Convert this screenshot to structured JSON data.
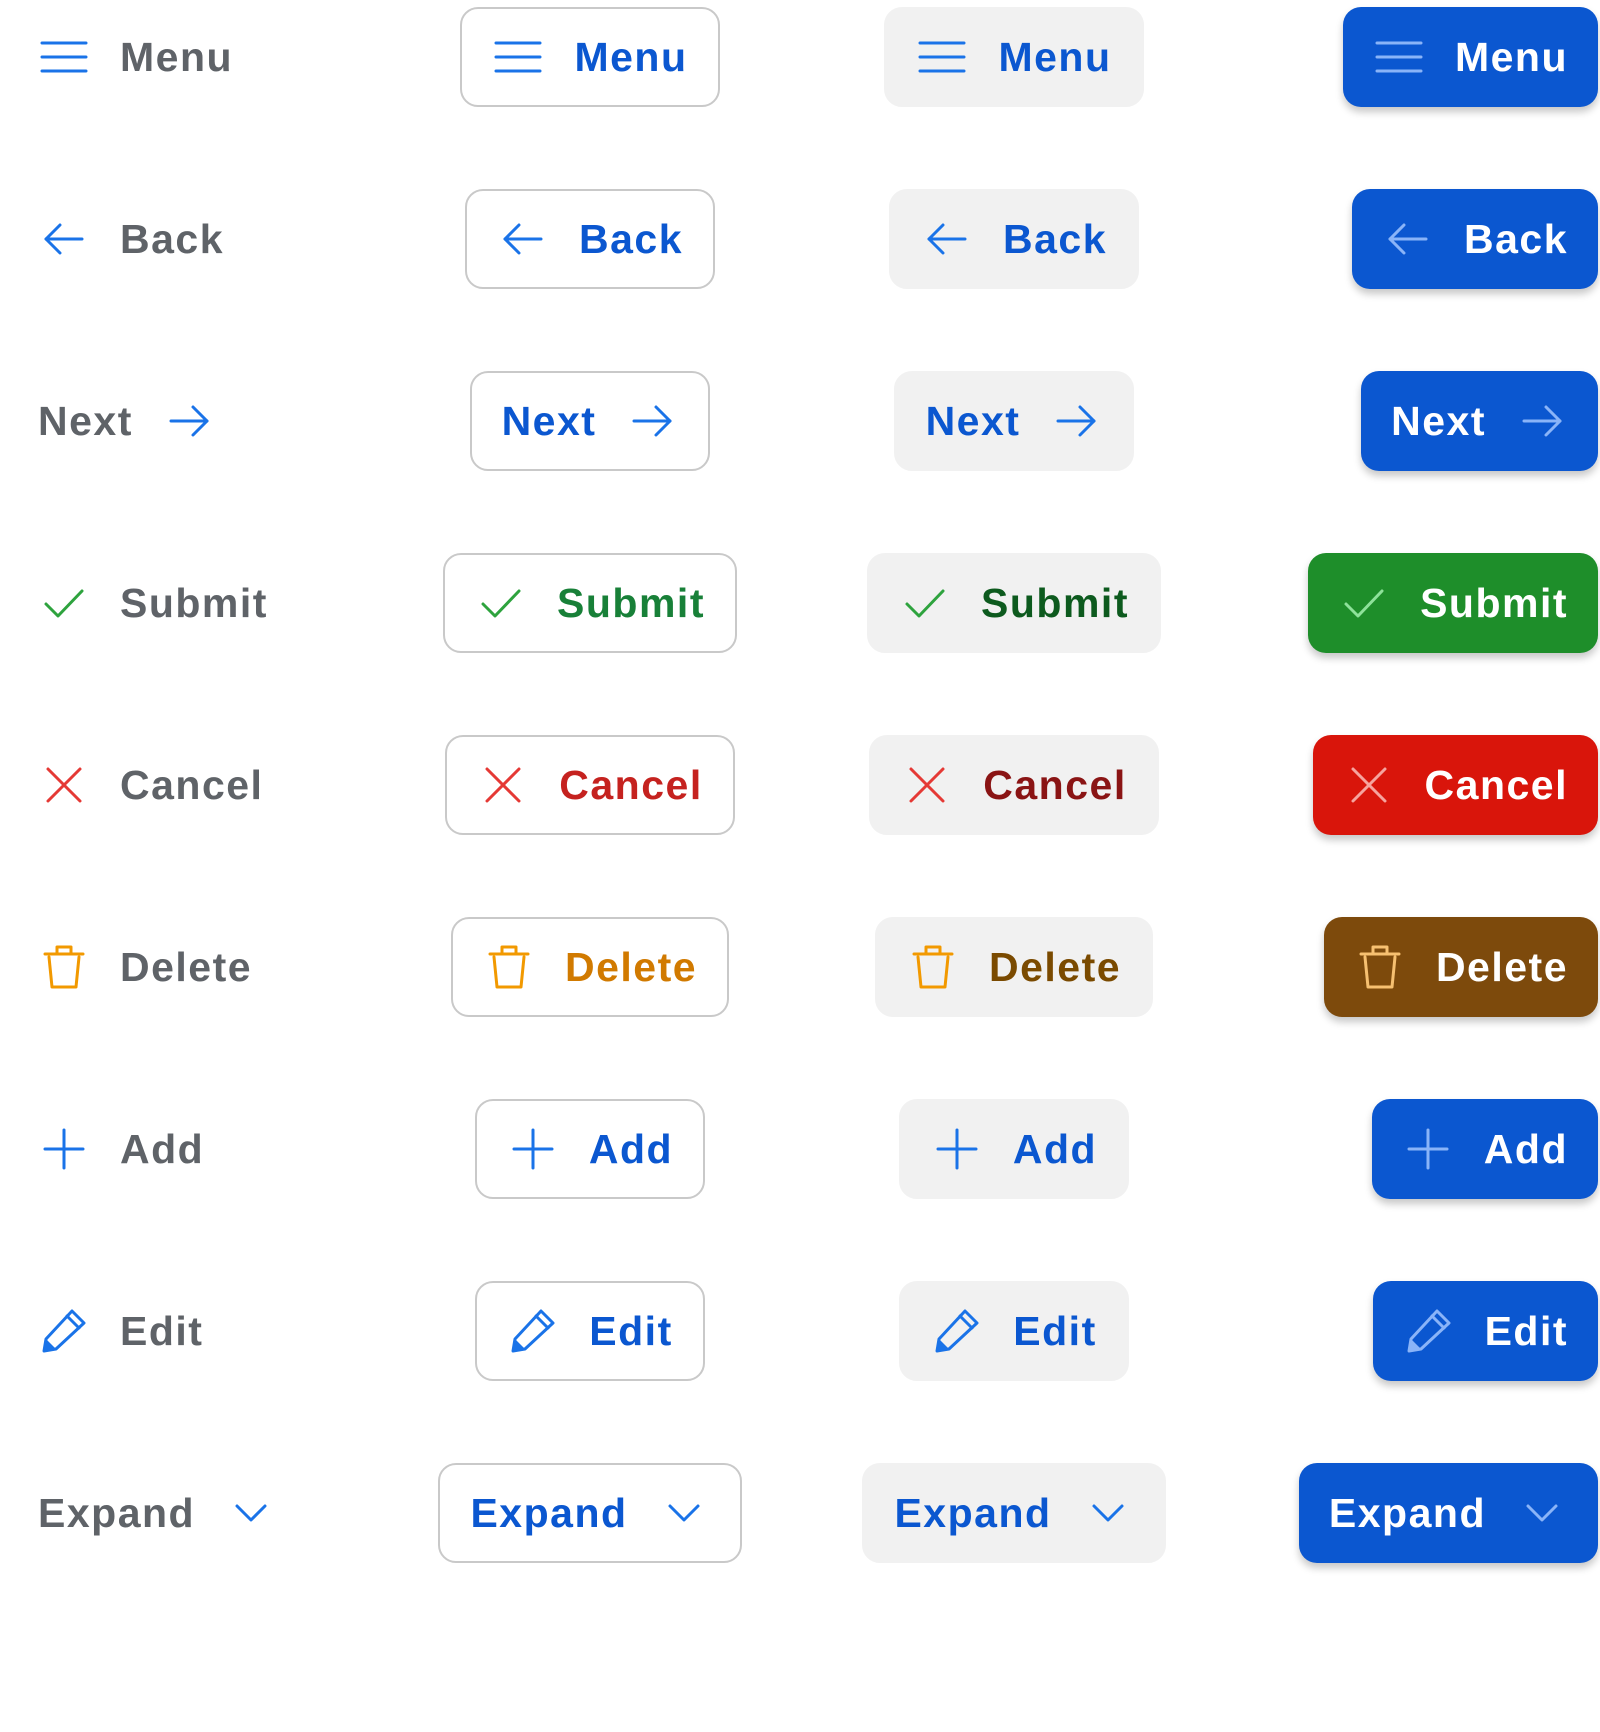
{
  "colors": {
    "plain_text": "#5f6368",
    "blue_icon": "#1a73e8",
    "blue_text": "#0b57d0",
    "blue_solid": "#0b57d0",
    "blue_solid_icon": "#8ab4f8",
    "green_icon": "#2ea33e",
    "green_text_outline": "#188038",
    "green_text_soft": "#0d5a1e",
    "green_solid": "#1e8e2a",
    "green_solid_icon": "#8ee29a",
    "red_icon": "#e53935",
    "red_text_outline": "#c5221f",
    "red_text_soft": "#8a1414",
    "red_solid": "#d9150b",
    "red_solid_icon": "#f6a39e",
    "orange_icon": "#f29900",
    "orange_text_outline": "#d17a00",
    "orange_text_soft": "#7a4a00",
    "brown_solid": "#7d4a0c",
    "brown_solid_icon": "#f6c071",
    "solid_text": "#ffffff",
    "outline_border": "#c9c9c9",
    "soft_bg": "#f1f1f1"
  },
  "rows": [
    {
      "key": "menu",
      "label": "Menu",
      "icon": "menu-icon",
      "icon_position": "left",
      "palette": "blue"
    },
    {
      "key": "back",
      "label": "Back",
      "icon": "arrow-left-icon",
      "icon_position": "left",
      "palette": "blue"
    },
    {
      "key": "next",
      "label": "Next",
      "icon": "arrow-right-icon",
      "icon_position": "right",
      "palette": "blue"
    },
    {
      "key": "submit",
      "label": "Submit",
      "icon": "check-icon",
      "icon_position": "left",
      "palette": "green"
    },
    {
      "key": "cancel",
      "label": "Cancel",
      "icon": "close-icon",
      "icon_position": "left",
      "palette": "red"
    },
    {
      "key": "delete",
      "label": "Delete",
      "icon": "trash-icon",
      "icon_position": "left",
      "palette": "orange"
    },
    {
      "key": "add",
      "label": "Add",
      "icon": "plus-icon",
      "icon_position": "left",
      "palette": "blue"
    },
    {
      "key": "edit",
      "label": "Edit",
      "icon": "pencil-icon",
      "icon_position": "left",
      "palette": "blue"
    },
    {
      "key": "expand",
      "label": "Expand",
      "icon": "chevron-down-icon",
      "icon_position": "right",
      "palette": "blue"
    }
  ],
  "variants": [
    "plain",
    "outline",
    "soft",
    "solid"
  ]
}
